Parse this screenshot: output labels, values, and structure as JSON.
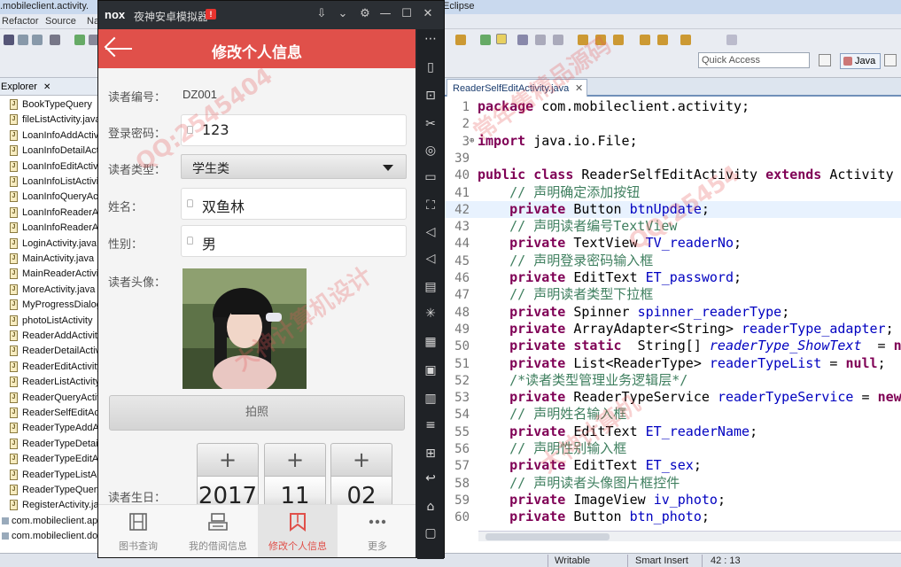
{
  "eclipse": {
    "title_left": ".mobileclient.activity.",
    "title_right": "Eclipse",
    "menus": [
      "Refactor",
      "Source",
      "Na"
    ],
    "quick_access": "Quick Access",
    "perspective": "Java",
    "explorer_title": "Explorer",
    "explorer_items": [
      "BookTypeQuery",
      "fileListActivity.java",
      "LoanInfoAddActivity",
      "LoanInfoDetailActivity",
      "LoanInfoEditActivity",
      "LoanInfoListActivity",
      "LoanInfoQueryActivity",
      "LoanInfoReaderActivity",
      "LoanInfoReaderActivity",
      "LoginActivity.java",
      "MainActivity.java",
      "MainReaderActivity",
      "MoreActivity.java",
      "MyProgressDialog",
      "photoListActivity",
      "ReaderAddActivity",
      "ReaderDetailActivity",
      "ReaderEditActivity",
      "ReaderListActivity",
      "ReaderQueryActivity",
      "ReaderSelfEditActivity",
      "ReaderTypeAddActivity",
      "ReaderTypeDetailActivity",
      "ReaderTypeEditActivity",
      "ReaderTypeListActivity",
      "ReaderTypeQueryActivity",
      "RegisterActivity.java",
      "com.mobileclient.app",
      "com.mobileclient.dom"
    ],
    "editor_tab": "ReaderSelfEditActivity.java",
    "code_lines": [
      {
        "n": "1",
        "html": "<span class=\"kw\">package</span> com.mobileclient.activity;"
      },
      {
        "n": "2",
        "html": ""
      },
      {
        "n": "3",
        "html": "<span class=\"kw\">import</span> java.io.File;"
      },
      {
        "n": "39",
        "html": ""
      },
      {
        "n": "40",
        "html": "<span class=\"kw\">public class</span> ReaderSelfEditActivity <span class=\"kw\">extends</span> Activity {"
      },
      {
        "n": "41",
        "html": "    <span class=\"cm\">// 声明确定添加按钮</span>"
      },
      {
        "n": "42",
        "html": "    <span class=\"kw\">private</span> Button <span class=\"fld\">btnUpdate</span>;"
      },
      {
        "n": "43",
        "html": "    <span class=\"cm\">// 声明读者编号TextView</span>"
      },
      {
        "n": "44",
        "html": "    <span class=\"kw\">private</span> TextView <span class=\"fld\">TV_readerNo</span>;"
      },
      {
        "n": "45",
        "html": "    <span class=\"cm\">// 声明登录密码输入框</span>"
      },
      {
        "n": "46",
        "html": "    <span class=\"kw\">private</span> EditText <span class=\"fld\">ET_password</span>;"
      },
      {
        "n": "47",
        "html": "    <span class=\"cm\">// 声明读者类型下拉框</span>"
      },
      {
        "n": "48",
        "html": "    <span class=\"kw\">private</span> Spinner <span class=\"fld\">spinner_readerType</span>;"
      },
      {
        "n": "49",
        "html": "    <span class=\"kw\">private</span> ArrayAdapter&lt;String&gt; <span class=\"fld\">readerType_adapter</span>;"
      },
      {
        "n": "50",
        "html": "    <span class=\"kw\">private static</span>  String[] <span class=\"it\">readerType_ShowText</span>  = <span class=\"kw\">nul</span>"
      },
      {
        "n": "51",
        "html": "    <span class=\"kw\">private</span> List&lt;ReaderType&gt; <span class=\"fld\">readerTypeList</span> = <span class=\"kw\">null</span>;"
      },
      {
        "n": "52",
        "html": "    <span class=\"cm\">/*读者类型管理业务逻辑层*/</span>"
      },
      {
        "n": "53",
        "html": "    <span class=\"kw\">private</span> ReaderTypeService <span class=\"fld\">readerTypeService</span> = <span class=\"kw\">new</span> R"
      },
      {
        "n": "54",
        "html": "    <span class=\"cm\">// 声明姓名输入框</span>"
      },
      {
        "n": "55",
        "html": "    <span class=\"kw\">private</span> EditText <span class=\"fld\">ET_readerName</span>;"
      },
      {
        "n": "56",
        "html": "    <span class=\"cm\">// 声明性别输入框</span>"
      },
      {
        "n": "57",
        "html": "    <span class=\"kw\">private</span> EditText <span class=\"fld\">ET_sex</span>;"
      },
      {
        "n": "58",
        "html": "    <span class=\"cm\">// 声明读者头像图片框控件</span>"
      },
      {
        "n": "59",
        "html": "    <span class=\"kw\">private</span> ImageView <span class=\"fld\">iv_photo</span>;"
      },
      {
        "n": "60",
        "html": "    <span class=\"kw\">private</span> Button <span class=\"fld\">btn_photo</span>;"
      }
    ],
    "status": {
      "mode": "Writable",
      "insert": "Smart Insert",
      "pos": "42 : 13"
    }
  },
  "nox": {
    "logo": "nox",
    "title": "夜神安卓模拟器",
    "badge": "!"
  },
  "app": {
    "header_title": "修改个人信息",
    "reader_no_label": "读者编号：",
    "reader_no": "DZ001",
    "password_label": "登录密码：",
    "password": "123",
    "reader_type_label": "读者类型：",
    "reader_type": "学生类",
    "name_label": "姓名：",
    "name": "双鱼林",
    "sex_label": "性别：",
    "sex": "男",
    "photo_label": "读者头像：",
    "photo_button": "拍照",
    "birthday_label": "读者生日：",
    "birthday": {
      "year": "2017",
      "month": "11",
      "day": "02"
    },
    "picker_plus": "+",
    "nav": [
      {
        "label": "图书查询"
      },
      {
        "label": "我的借阅信息"
      },
      {
        "label": "修改个人信息"
      },
      {
        "label": "更多"
      }
    ]
  },
  "watermarks": [
    "QQ:2545404",
    "常年售精品源码",
    "大神计算机设计",
    "QQ:25454",
    "大神计算机"
  ],
  "colors": {
    "header": "#e0504a",
    "accent": "#e0504a",
    "emulator": "#25282c"
  }
}
